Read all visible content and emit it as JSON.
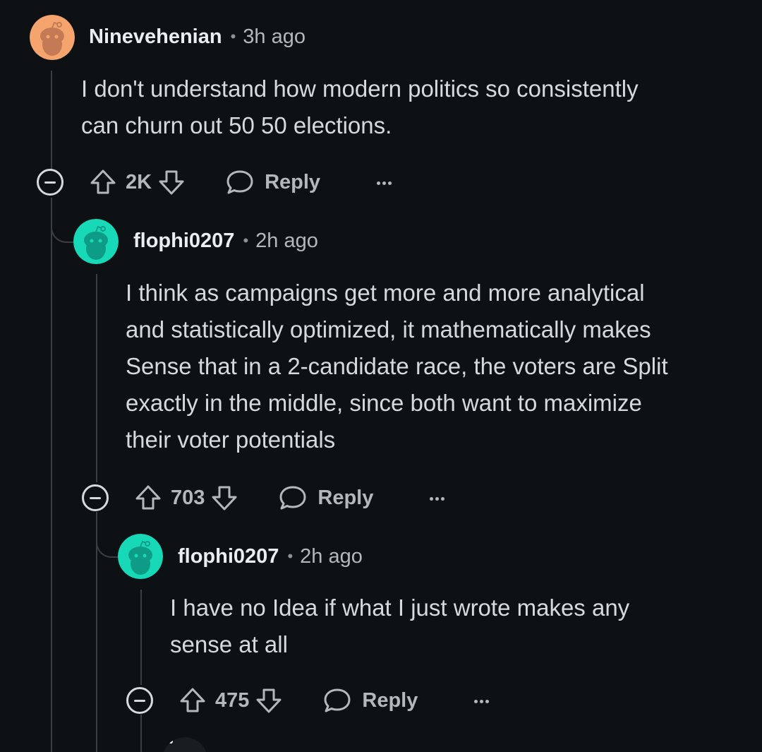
{
  "comments": [
    {
      "username": "Ninevehenian",
      "separator": "•",
      "time": "3h ago",
      "avatar_color": "#f5a46d",
      "avatar_icon": "snoo-avatar-icon",
      "body_lines": [
        "I don't understand how modern politics so consistently",
        "can churn out 50 50 elections."
      ],
      "score": "2K",
      "reply_label": "Reply"
    },
    {
      "username": "flophi0207",
      "separator": "•",
      "time": "2h ago",
      "avatar_color": "#17d9b8",
      "avatar_icon": "snoo-avatar-icon",
      "body_lines": [
        "I think as campaigns get more and more analytical",
        "and statistically optimized, it mathematically makes",
        "Sense that in a 2-candidate race, the voters are Split",
        "exactly in the middle, since both want to maximize",
        "their voter potentials"
      ],
      "score": "703",
      "reply_label": "Reply"
    },
    {
      "username": "flophi0207",
      "separator": "•",
      "time": "2h ago",
      "avatar_color": "#17d9b8",
      "avatar_icon": "snoo-avatar-icon",
      "body_lines": [
        "I have no Idea if what I just wrote makes any",
        "sense at all"
      ],
      "score": "475",
      "reply_label": "Reply"
    }
  ],
  "colors": {
    "background": "#0e1113",
    "text": "#d7dadc",
    "meta": "#b3b8bb",
    "thread_line": "#3a3f44"
  },
  "icons": {
    "collapse": "collapse-minus-icon",
    "upvote": "upvote-arrow-icon",
    "downvote": "downvote-arrow-icon",
    "reply": "speech-bubble-icon",
    "more": "more-dots-icon"
  }
}
